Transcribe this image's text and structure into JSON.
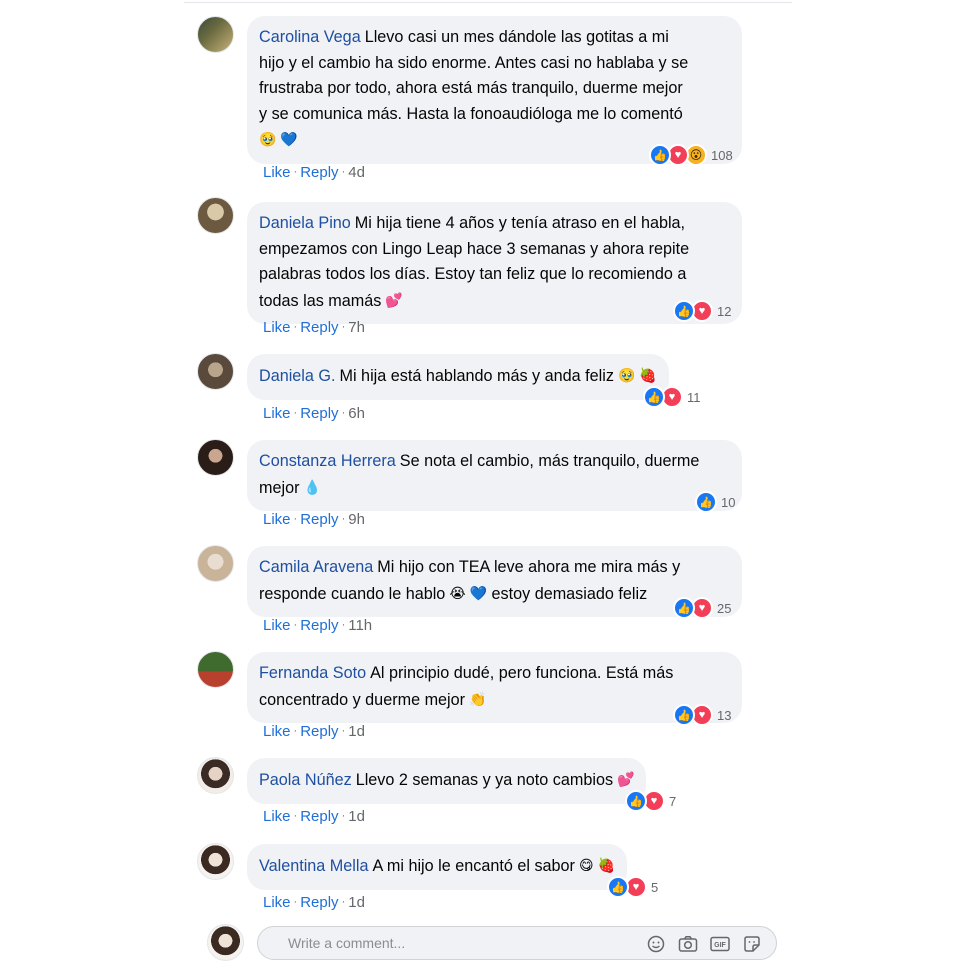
{
  "actions": {
    "like": "Like",
    "reply": "Reply",
    "dot": "·"
  },
  "comments": [
    {
      "author": "Carolina Vega",
      "lines": [
        "Llevo casi un mes dándole las gotitas a mi",
        "hijo y el cambio ha sido enorme. Antes casi no hablaba y se",
        "frustraba por todo, ahora está más tranquilo, duerme mejor",
        "y se comunica más. Hasta la fonoaudióloga me lo comentó"
      ],
      "emojis": "🥹 💙",
      "reactions": [
        "like",
        "love",
        "wow"
      ],
      "count": "108",
      "time": "4d",
      "avatar_colors": [
        "#3b4a3a",
        "#c8b37a"
      ]
    },
    {
      "author": "Daniela Pino",
      "text": "Mi hija tiene 4 años y tenía atraso en el habla, empezamos con Lingo Leap hace 3 semanas y ahora repite palabras todos los días. Estoy tan feliz que lo recomiendo a todas las mamás",
      "emojis": "💕",
      "reactions": [
        "like",
        "love"
      ],
      "count": "12",
      "time": "7h",
      "avatar_colors": [
        "#6b5a40",
        "#d9c9a8"
      ]
    },
    {
      "author": "Daniela G.",
      "text": "Mi hija está hablando más y anda feliz",
      "emojis": "🥹 🍓",
      "reactions": [
        "like",
        "love"
      ],
      "count": "11",
      "time": "6h",
      "avatar_colors": [
        "#5a4a3c",
        "#b9a48c"
      ]
    },
    {
      "author": "Constanza Herrera",
      "text": "Se nota el cambio, más tranquilo, duerme mejor",
      "emojis": "💧",
      "reactions": [
        "like"
      ],
      "count": "10",
      "time": "9h",
      "avatar_colors": [
        "#2a1d18",
        "#caa58f"
      ]
    },
    {
      "author": "Camila Aravena",
      "text": "Mi hijo con TEA leve ahora me mira más y responde cuando le hablo",
      "emojis": "😭 💙",
      "tail": "estoy demasiado feliz",
      "reactions": [
        "like",
        "love"
      ],
      "count": "25",
      "time": "11h",
      "avatar_colors": [
        "#c9b49a",
        "#e8ddd0"
      ]
    },
    {
      "author": "Fernanda Soto",
      "text": "Al principio dudé, pero funciona. Está más concentrado y duerme mejor",
      "emojis": "👏",
      "reactions": [
        "like",
        "love"
      ],
      "count": "13",
      "time": "1d",
      "avatar_colors": [
        "#3f6b2e",
        "#b8412d"
      ]
    },
    {
      "author": "Paola Núñez",
      "text": "Llevo 2 semanas y ya noto cambios",
      "emojis": "💕",
      "reactions": [
        "like",
        "love"
      ],
      "count": "7",
      "time": "1d",
      "avatar_colors": [
        "#3a2b24",
        "#e6d3c5"
      ]
    },
    {
      "author": "Valentina Mella",
      "text": "A mi hijo le encantó el sabor",
      "emojis": "😋 🍓",
      "reactions": [
        "like",
        "love"
      ],
      "count": "5",
      "time": "1d",
      "avatar_colors": [
        "#3b2a22",
        "#efe3d8"
      ]
    }
  ],
  "composer": {
    "placeholder": "Write a comment...",
    "tools": [
      "emoji-icon",
      "camera-icon",
      "gif-icon",
      "sticker-icon"
    ]
  },
  "colors": {
    "author": "#1f4fa0",
    "action": "#1f6fd6",
    "bubble": "#f0f2f5",
    "like": "#1877f2",
    "love": "#f33e58"
  }
}
